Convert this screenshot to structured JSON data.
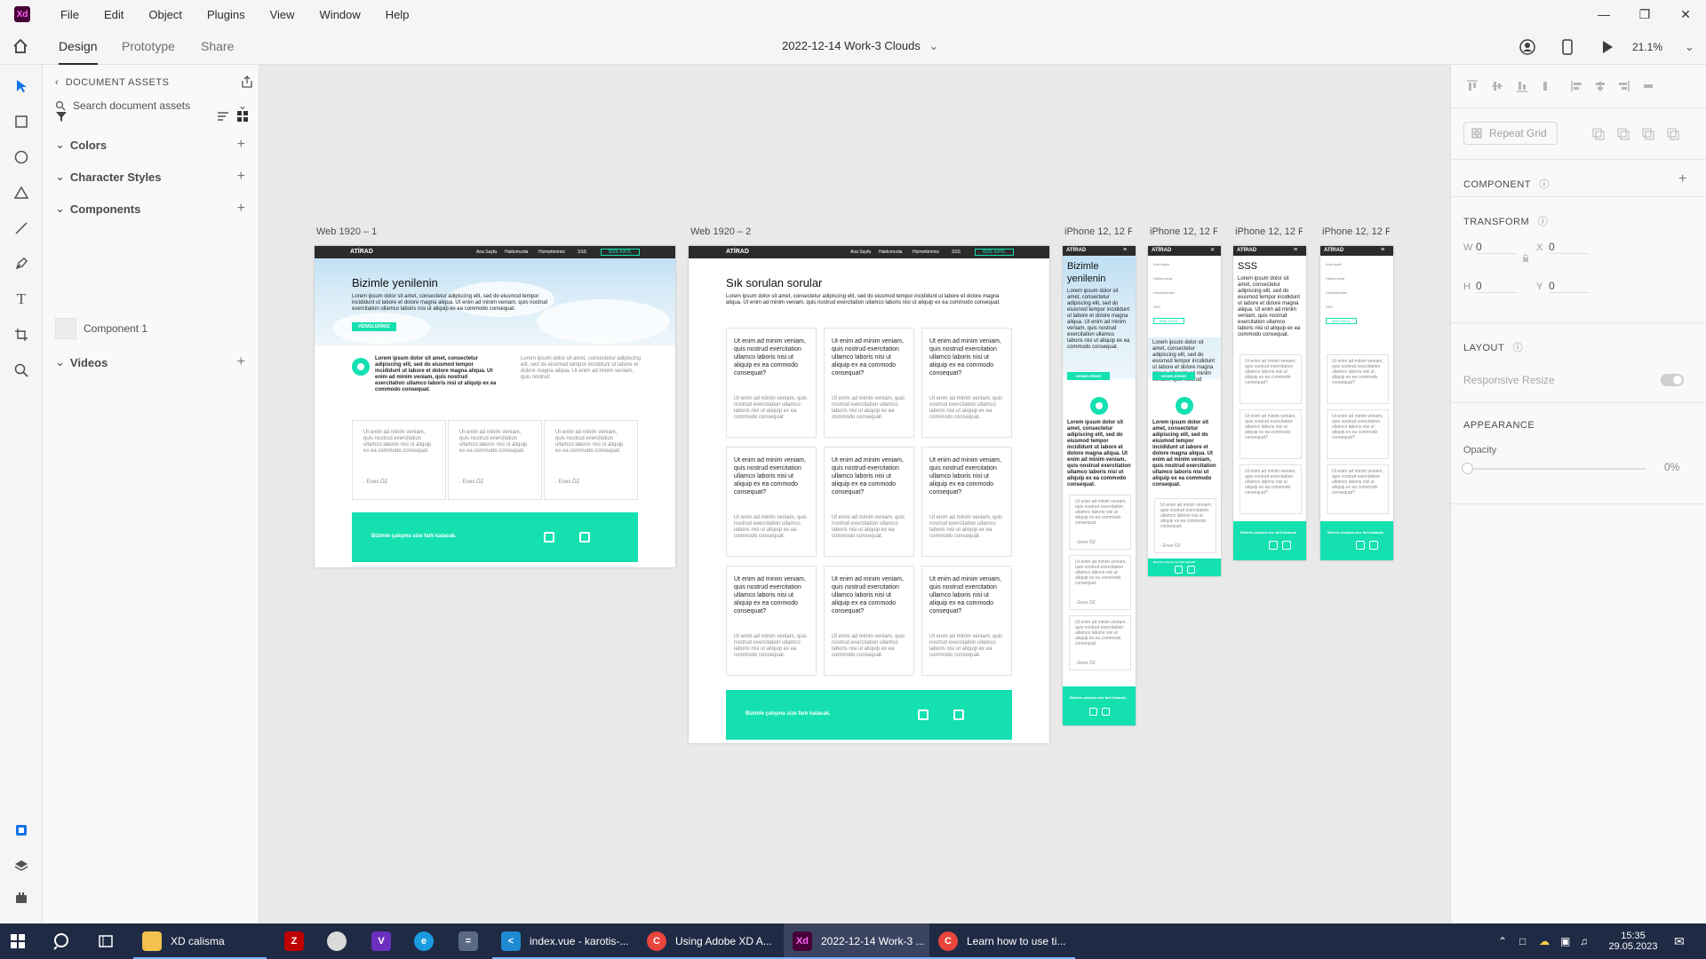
{
  "app": {
    "logo": "Xd"
  },
  "menu": [
    "File",
    "Edit",
    "Object",
    "Plugins",
    "View",
    "Window",
    "Help"
  ],
  "tabs": {
    "design": "Design",
    "prototype": "Prototype",
    "share": "Share"
  },
  "document": {
    "title": "2022-12-14 Work-3 Clouds",
    "zoom": "21.1%"
  },
  "assets": {
    "header": "DOCUMENT ASSETS",
    "search_placeholder": "Search document assets",
    "sections": {
      "colors": "Colors",
      "character_styles": "Character Styles",
      "components": "Components",
      "videos": "Videos"
    },
    "component_1": "Component 1"
  },
  "artboards": {
    "web1": {
      "label": "Web 1920 – 1",
      "logo": "ATİRAD",
      "nav": [
        "Ana Sayfa",
        "Hakkımızda",
        "Hizmetlerimiz",
        "SSS"
      ],
      "nav_cta": "BİZE KATIL",
      "hero_title": "Bizimle yenilenin",
      "hero_body": "Lorem ipsum dolor sit amet, consectetur adipiscing elit, sed do eiusmod tempor incididunt ut labore et dolore magna aliqua. Ut enim ad minim veniam, quis nostrud exercitation ullamco laboris nisi ut aliquip ex ea commodo consequat.",
      "hero_button": "HİZMELERİMİZ",
      "feature_bold": "Lorem ipsum dolor sit amet, consectetur adipiscing elit, sed do eiusmod tempor incididunt ut labore et dolore magna aliqua. Ut enim ad minim veniam, quis nostrud exercitation ullamco laboris nisi ut aliquip ex ea commodo consequat.",
      "feature_light": "Lorem ipsum dolor sit amet, consectetur adipiscing elit, sed do eiusmod tempor incididunt ut labore et dolore magna aliqua. Ut enim ad minim veniam, quis nostrud",
      "testimonial": "Ut enim ad minim veniam, quis nostrud exercitation ullamco laboris nisi ut aliquip ex ea commodo consequat.",
      "testimonial_author": "- Enes ÖZ",
      "footer_text": "Bizimle çalışma size fark katacak."
    },
    "web2": {
      "label": "Web 1920 – 2",
      "logo": "ATİRAD",
      "nav": [
        "Ana Sayfa",
        "Hakkımızda",
        "Hizmetlerimiz",
        "SSS"
      ],
      "nav_cta": "BİZE KATIL",
      "title": "Sık sorulan sorular",
      "intro": "Lorem ipsum dolor sit amet, consectetur adipiscing elit, sed do eiusmod tempor incididunt ut labore et dolore magna aliqua. Ut enim ad minim veniam, quis nostrud exercitation ullamco laboris nisi ut aliquip ex ea commodo consequat.",
      "faq_q": "Ut enim ad minim veniam, quis nostrud exercitation ullamco laboris nisi ut aliquip ex ea commodo consequat?",
      "faq_a": "Ut enim ad minim veniam, quis nostrud exercitation ullamco laboris nisi ut aliquip ex ea commodo consequat.",
      "footer_text": "Bizimle çalışma size fark katacak."
    },
    "mobile": {
      "label": "iPhone 12, 12 P...",
      "logo": "ATİRAD",
      "hero_title": "Bizimle yenilenin",
      "faq_title": "SSS",
      "button": "HİZMELERİMİZ",
      "menu_items": [
        "Ana sayfa",
        "Hakkımızda",
        "Hizmetlerimiz",
        "SSS"
      ],
      "menu_cta": "BİZE KATIL",
      "author": "- Enes ÖZ",
      "footer_text": "Bizimle çalışma size fark katacak."
    }
  },
  "props": {
    "repeat_grid": "Repeat Grid",
    "component": "COMPONENT",
    "transform": "TRANSFORM",
    "w_label": "W",
    "w_value": "0",
    "h_label": "H",
    "h_value": "0",
    "x_label": "X",
    "x_value": "0",
    "y_label": "Y",
    "y_value": "0",
    "layout": "LAYOUT",
    "responsive_resize": "Responsive Resize",
    "appearance": "APPEARANCE",
    "opacity_label": "Opacity",
    "opacity_value": "0%"
  },
  "taskbar": {
    "items": [
      "XD calisma",
      "index.vue - karotis-...",
      "Using Adobe XD A...",
      "2022-12-14 Work-3 ...",
      "Learn how to use ti..."
    ],
    "time": "15:35",
    "date": "29.05.2023"
  }
}
